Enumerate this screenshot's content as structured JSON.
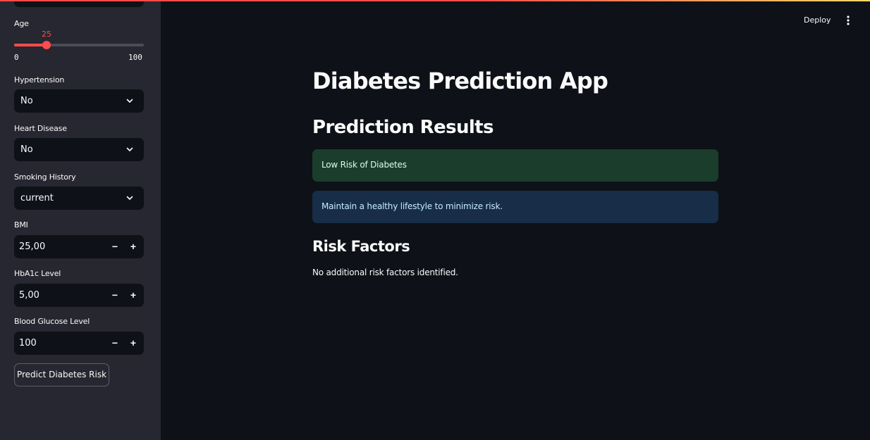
{
  "sidebar": {
    "age": {
      "label": "Age",
      "value": "25",
      "min": "0",
      "max": "100"
    },
    "hypertension": {
      "label": "Hypertension",
      "value": "No"
    },
    "heart_disease": {
      "label": "Heart Disease",
      "value": "No"
    },
    "smoking_history": {
      "label": "Smoking History",
      "value": "current"
    },
    "bmi": {
      "label": "BMI",
      "value": "25,00"
    },
    "hba1c": {
      "label": "HbA1c Level",
      "value": "5,00"
    },
    "glucose": {
      "label": "Blood Glucose Level",
      "value": "100"
    },
    "stepper": {
      "minus": "−",
      "plus": "+"
    },
    "predict_button": "Predict Diabetes Risk"
  },
  "header": {
    "deploy": "Deploy",
    "menu_icon": "more-vertical-icon"
  },
  "main": {
    "title": "Diabetes Prediction App",
    "results_heading": "Prediction Results",
    "success_message": "Low Risk of Diabetes",
    "info_message": "Maintain a healthy lifestyle to minimize risk.",
    "risk_heading": "Risk Factors",
    "risk_text": "No additional risk factors identified."
  },
  "colors": {
    "accent": "#ff4b4b",
    "background": "#0e1117",
    "sidebar": "#262730",
    "success_bg": "#1b3d2b",
    "info_bg": "#172d48"
  }
}
